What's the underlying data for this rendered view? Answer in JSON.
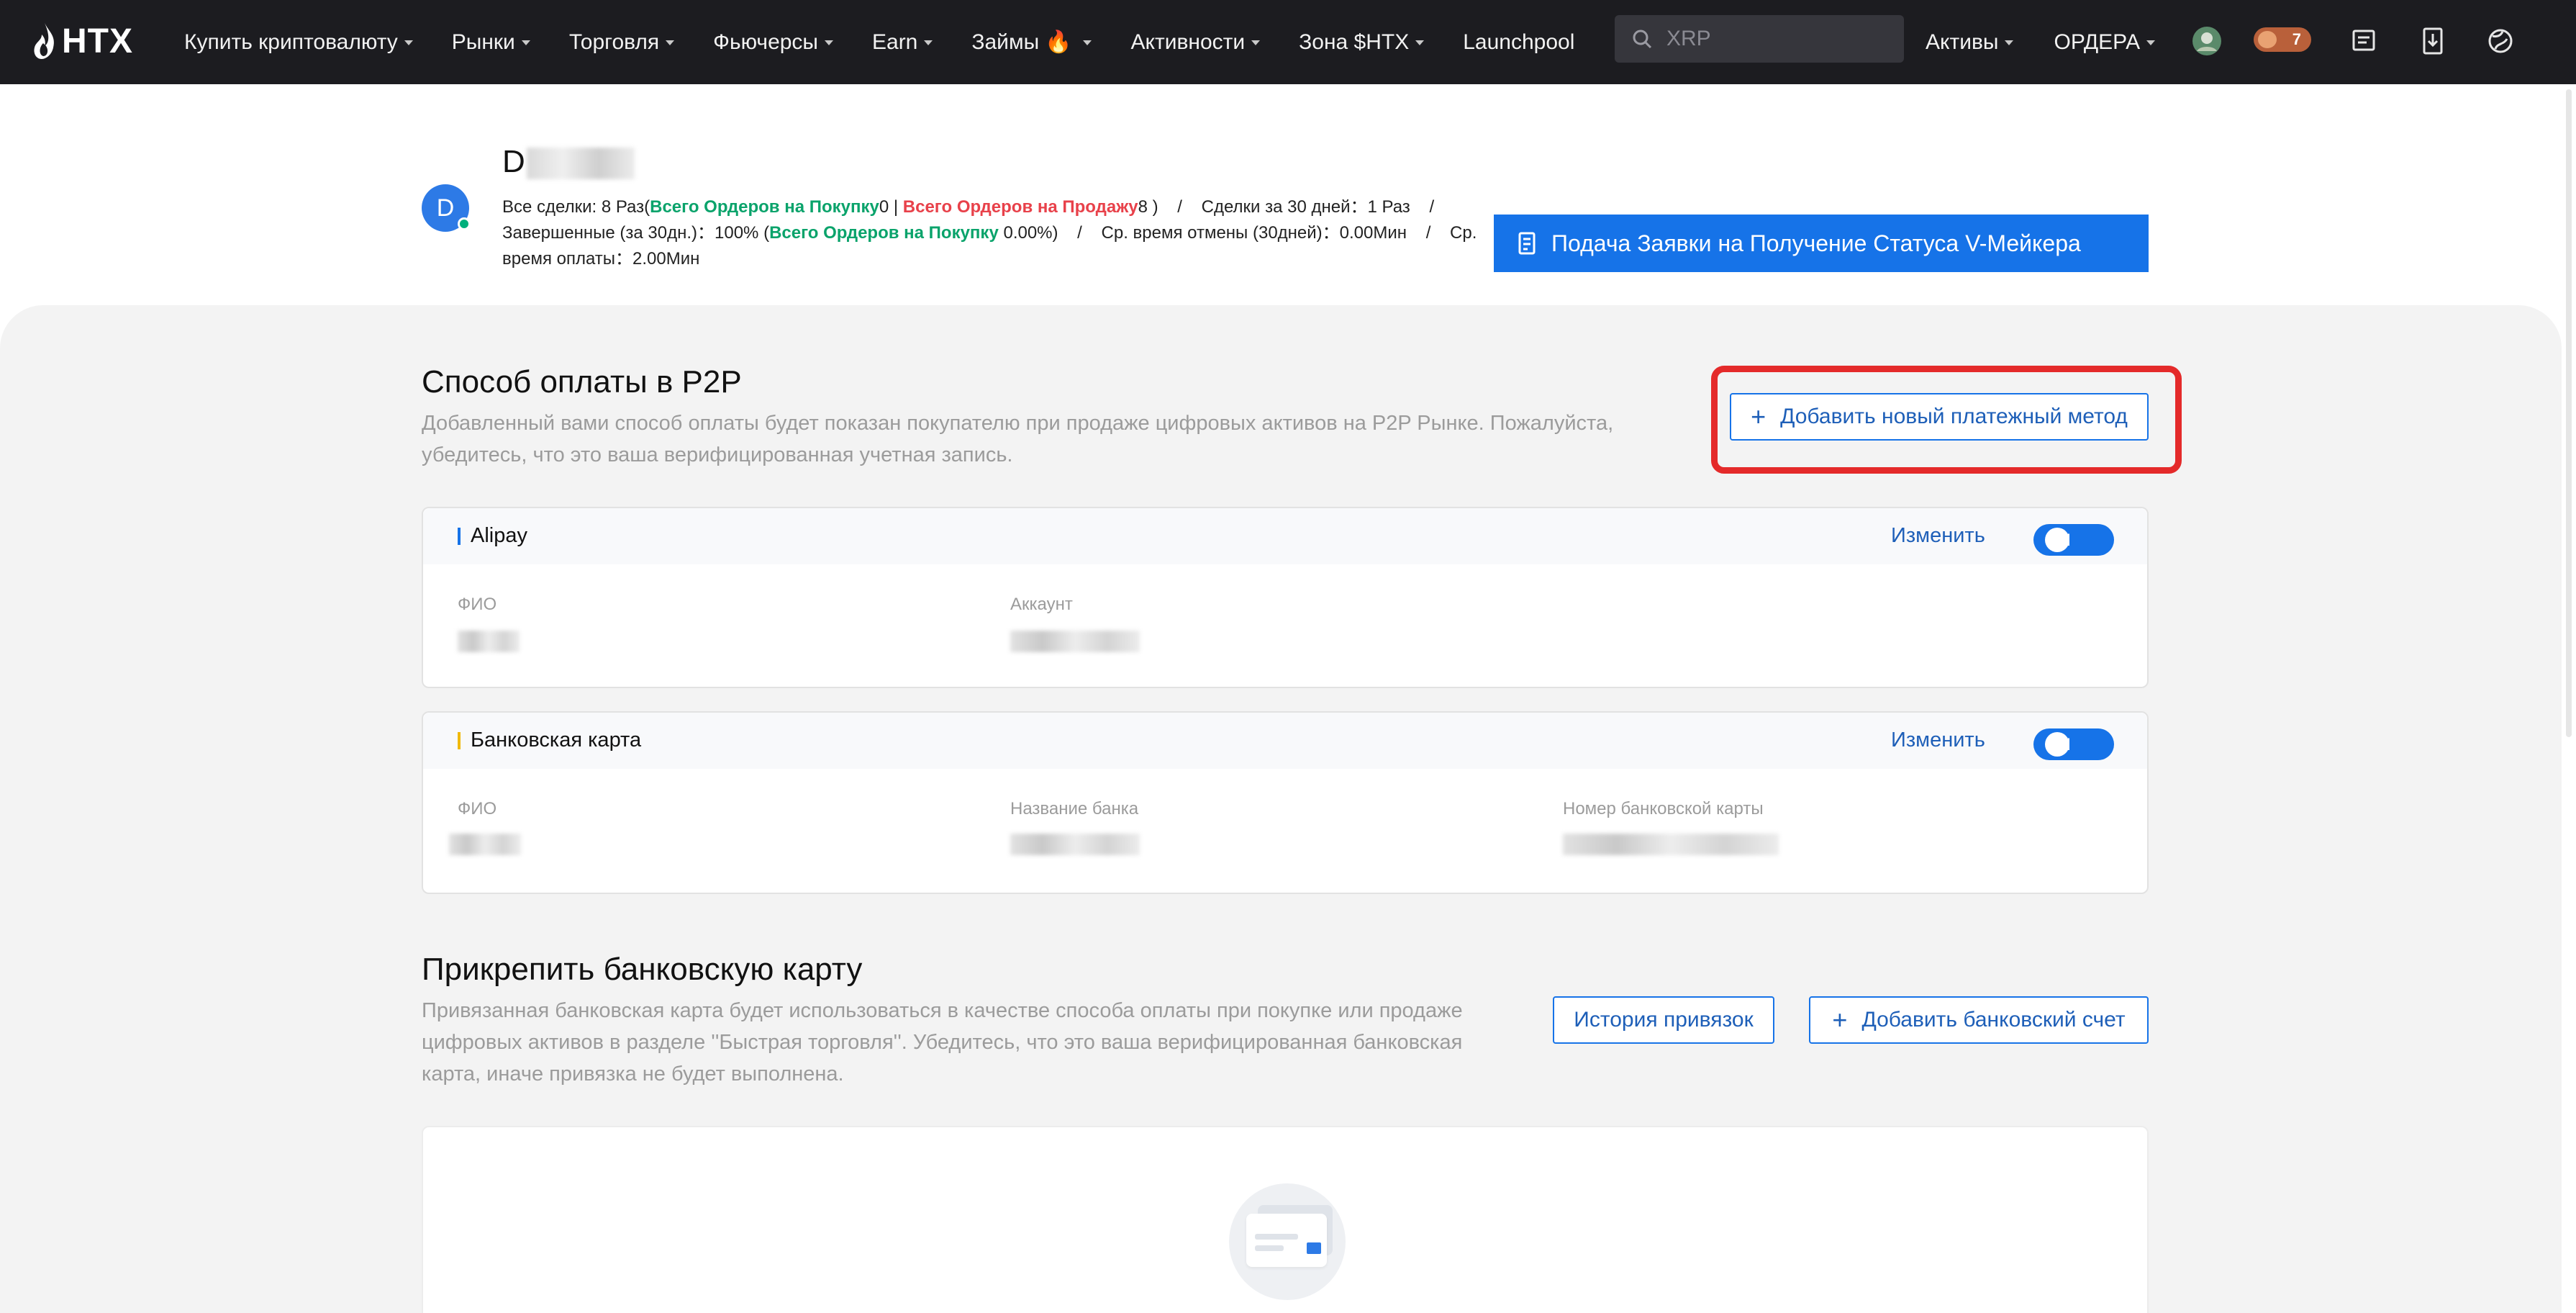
{
  "nav": {
    "logo": "HTX",
    "menu": [
      {
        "label": "Купить криптовалюту",
        "caret": true
      },
      {
        "label": "Рынки",
        "caret": true
      },
      {
        "label": "Торговля",
        "caret": true
      },
      {
        "label": "Фьючерсы",
        "caret": true
      },
      {
        "label": "Earn",
        "caret": true
      },
      {
        "label": "Займы",
        "caret": true,
        "flame": true
      },
      {
        "label": "Активности",
        "caret": true
      },
      {
        "label": "Зона $HTX",
        "caret": true
      },
      {
        "label": "Launchpool",
        "caret": false
      }
    ],
    "search_placeholder": "XRP",
    "assets": "Активы",
    "orders": "ОРДЕРА",
    "notification_count": "7",
    "icons": [
      "search-icon",
      "avatar-icon",
      "rewards-icon",
      "messages-icon",
      "download-icon",
      "globe-icon"
    ]
  },
  "profile": {
    "avatar_letter": "D",
    "name_visible": "D",
    "stats": {
      "all_deals": "Все сделки: 8 Раз(",
      "buy_orders_label": "Всего Ордеров на Покупку",
      "buy_orders_value": "0 | ",
      "sell_orders_label": "Всего Ордеров на Продажу",
      "sell_orders_value": "8 )",
      "deals_30d": "Сделки за 30 дней：1 Раз",
      "completed": "Завершенные (за 30дн.)：100%  (",
      "completed_buy_label": "Всего Ордеров на Покупку",
      "completed_buy_value": " 0.00%)",
      "avg_cancel": "Ср. время отмены (30дней)：0.00Мин",
      "avg_pay": "Ср. время оплаты：2.00Мин"
    },
    "vmaker_button": "Подача Заявки на Получение Статуса V-Мейкера"
  },
  "p2p": {
    "title": "Способ оплаты в P2P",
    "desc_line1": "Добавленный вами способ оплаты будет показан покупателю при продаже цифровых активов на P2P Рынке. Пожалуйста,",
    "desc_line2": "убедитесь, что это ваша верифицированная учетная запись.",
    "add_button": "Добавить новый платежный метод",
    "methods": [
      {
        "name": "Alipay",
        "edit": "Изменить",
        "toggle": "ON",
        "accent": "#1673e8",
        "fields": [
          "ФИО",
          "Аккаунт"
        ]
      },
      {
        "name": "Банковская карта",
        "edit": "Изменить",
        "toggle": "ON",
        "accent": "#f0b90b",
        "fields": [
          "ФИО",
          "Название банка",
          "Номер банковской карты"
        ]
      }
    ]
  },
  "bank": {
    "title": "Прикрепить банковскую карту",
    "desc_line1": "Привязанная банковская карта будет использоваться в качестве способа оплаты при покупке или продаже",
    "desc_line2": "цифровых активов в разделе ''Быстрая торговля''. Убедитесь, что это ваша верифицированная банковская",
    "desc_line3": "карта, иначе привязка не будет выполнена.",
    "history_button": "История привязок",
    "add_button": "Добавить банковский счет"
  },
  "colors": {
    "nav_bg": "#1c1c20",
    "accent": "#1673e8",
    "green": "#0aa36b",
    "red": "#e8414a",
    "highlight": "#e42a2a"
  }
}
